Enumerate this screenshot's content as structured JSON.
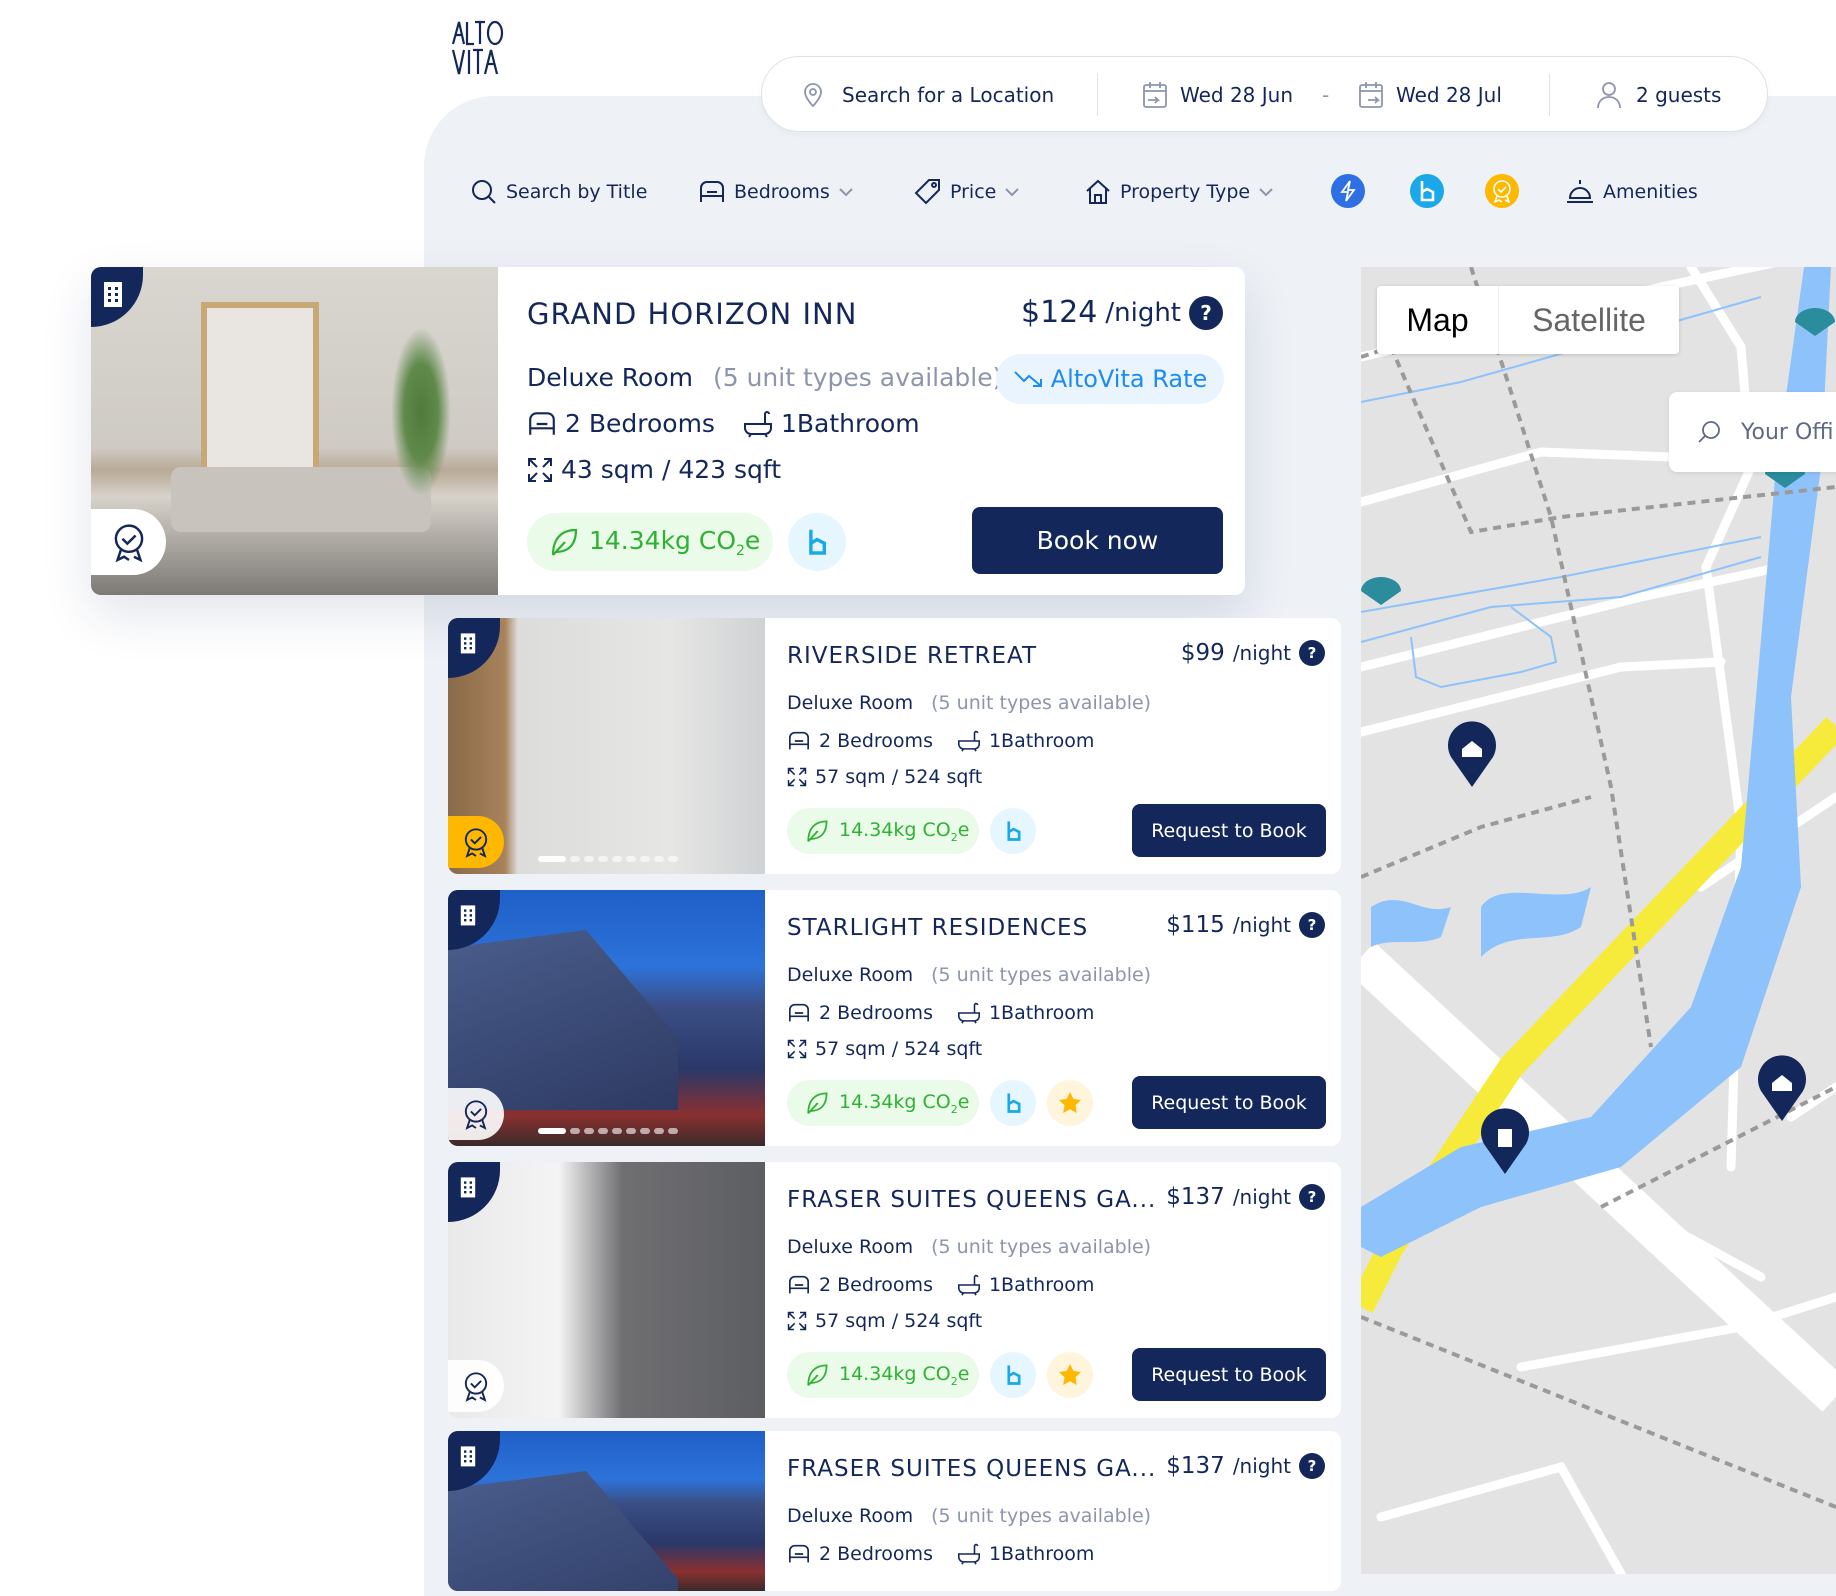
{
  "header": {
    "logo_text": "ALTO VITA"
  },
  "search": {
    "location_placeholder": "Search for a Location",
    "check_in": "Wed 28 Jun",
    "separator": "-",
    "check_out": "Wed 28 Jul",
    "guests": "2 guests"
  },
  "filters": {
    "title_search": "Search by Title",
    "bedrooms": "Bedrooms",
    "price": "Price",
    "property_type": "Property Type",
    "amenities": "Amenities",
    "toggles": [
      {
        "icon": "lightning-icon",
        "color": "#2f6fe4"
      },
      {
        "icon": "bookable-icon",
        "color": "#1aa8ea"
      },
      {
        "icon": "award-icon",
        "color": "#ffb800"
      }
    ]
  },
  "featured": {
    "name": "GRAND HORIZON INN",
    "price": "$124",
    "per": "/night",
    "room": "Deluxe Room",
    "units": "(5 unit types available)",
    "rate_label": "AltoVita Rate",
    "bedrooms": "2 Bedrooms",
    "bathrooms": "1Bathroom",
    "size": "43 sqm / 423 sqft",
    "co2": "14.34kg CO",
    "co2_sub": "2",
    "co2_suffix": "e",
    "cta": "Book now"
  },
  "listings": [
    {
      "name": "RIVERSIDE RETREAT",
      "price": "$99",
      "per": "/night",
      "room": "Deluxe Room",
      "units": "(5 unit types available)",
      "bedrooms": "2 Bedrooms",
      "bathrooms": "1Bathroom",
      "size": "57 sqm / 524 sqft",
      "co2": "14.34kg CO",
      "co2_sub": "2",
      "co2_suffix": "e",
      "cta": "Request to Book",
      "star": false,
      "award_gold": true,
      "photo": "bath"
    },
    {
      "name": "STARLIGHT RESIDENCES",
      "price": "$115",
      "per": "/night",
      "room": "Deluxe Room",
      "units": "(5 unit types available)",
      "bedrooms": "2 Bedrooms",
      "bathrooms": "1Bathroom",
      "size": "57 sqm / 524 sqft",
      "co2": "14.34kg CO",
      "co2_sub": "2",
      "co2_suffix": "e",
      "cta": "Request to Book",
      "star": true,
      "award_gold": false,
      "photo": "street"
    },
    {
      "name": "FRASER SUITES QUEENS GA...",
      "price": "$137",
      "per": "/night",
      "room": "Deluxe Room",
      "units": "(5 unit types available)",
      "bedrooms": "2 Bedrooms",
      "bathrooms": "1Bathroom",
      "size": "57 sqm / 524 sqft",
      "co2": "14.34kg CO",
      "co2_sub": "2",
      "co2_suffix": "e",
      "cta": "Request to Book",
      "star": true,
      "award_gold": false,
      "photo": "room"
    },
    {
      "name": "FRASER SUITES QUEENS GA...",
      "price": "$137",
      "per": "/night",
      "room": "Deluxe Room",
      "units": "(5 unit types available)",
      "bedrooms": "2 Bedrooms",
      "bathrooms": "1Bathroom",
      "photo": "street"
    }
  ],
  "map": {
    "tab_map": "Map",
    "tab_satellite": "Satellite",
    "search_placeholder": "Your Offi",
    "colors": {
      "land": "#e3e3e3",
      "water": "#8ec2fb",
      "highway": "#f6ea3a",
      "pin": "#14275a",
      "office_pin": "#2a8c9c"
    }
  }
}
